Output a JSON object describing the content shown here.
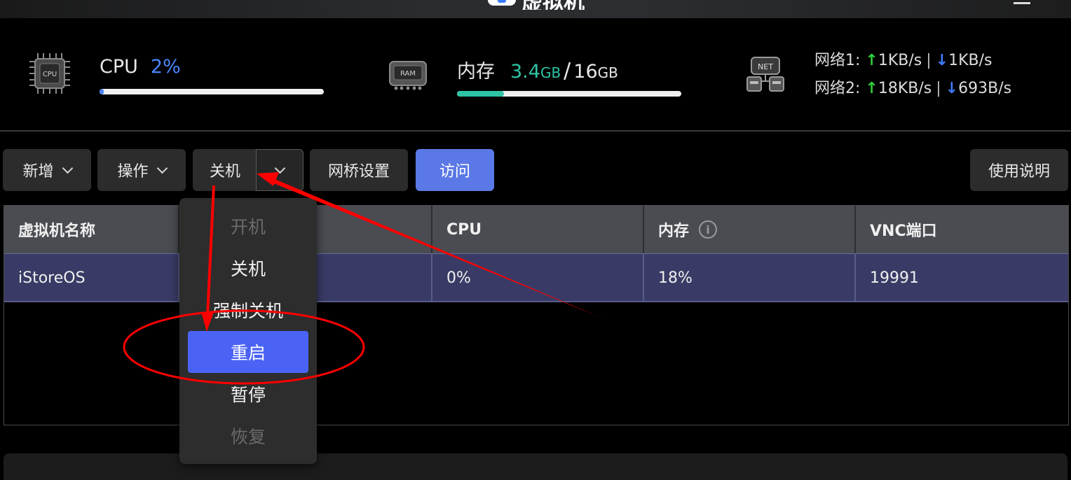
{
  "window": {
    "title": "虚拟机"
  },
  "stats": {
    "cpu": {
      "icon": "cpu-chip-icon",
      "chip_label": "CPU",
      "label": "CPU",
      "value": "2%",
      "progress": 0.02,
      "fill_color": "#4a86ff"
    },
    "memory": {
      "icon": "ram-chip-icon",
      "chip_label": "RAM",
      "label": "内存",
      "used": "3.4",
      "used_unit": "GB",
      "slash": "/",
      "total": "16",
      "total_unit": "GB",
      "progress": 0.21,
      "fill_color": "#2ec4a5"
    },
    "network": {
      "icon": "network-icon",
      "chip_label": "NET",
      "lines": [
        {
          "label": "网络1:",
          "up": "1KB/s",
          "down": "1KB/s"
        },
        {
          "label": "网络2:",
          "up": "18KB/s",
          "down": "693B/s"
        }
      ],
      "up_arrow": "↑",
      "down_arrow": "↓",
      "separator": "|"
    }
  },
  "toolbar": {
    "add_label": "新增",
    "operate_label": "操作",
    "shutdown_label": "关机",
    "bridge_label": "网桥设置",
    "visit_label": "访问",
    "manual_label": "使用说明"
  },
  "table": {
    "headers": [
      "虚拟机名称",
      "",
      "CPU",
      "内存",
      "VNC端口"
    ],
    "memory_info_icon": "i",
    "rows": [
      {
        "name": "iStoreOS",
        "status": "",
        "cpu": "0%",
        "memory": "18%",
        "vnc_port": "19991"
      }
    ]
  },
  "dropdown": {
    "items": [
      {
        "label": "开机",
        "state": "disabled"
      },
      {
        "label": "关机",
        "state": "normal"
      },
      {
        "label": "强制关机",
        "state": "normal"
      },
      {
        "label": "重启",
        "state": "active"
      },
      {
        "label": "暂停",
        "state": "normal"
      },
      {
        "label": "恢复",
        "state": "disabled"
      }
    ]
  },
  "colors": {
    "accent": "#5b79e6",
    "active_item": "#4a63f5",
    "selected_row": "#393b66",
    "annotation": "#ff0000"
  }
}
